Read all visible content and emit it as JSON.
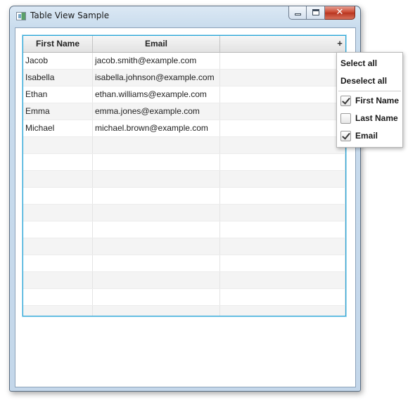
{
  "window": {
    "title": "Table View Sample"
  },
  "table": {
    "columns": [
      "First Name",
      "Email",
      ""
    ],
    "menu_button": "+",
    "rows": [
      {
        "first_name": "Jacob",
        "email": "jacob.smith@example.com"
      },
      {
        "first_name": "Isabella",
        "email": "isabella.johnson@example.com"
      },
      {
        "first_name": "Ethan",
        "email": "ethan.williams@example.com"
      },
      {
        "first_name": "Emma",
        "email": "emma.jones@example.com"
      },
      {
        "first_name": "Michael",
        "email": "michael.brown@example.com"
      }
    ],
    "visible_row_count": 17
  },
  "column_menu": {
    "select_all": "Select all",
    "deselect_all": "Deselect all",
    "columns": [
      {
        "label": "First Name",
        "checked": true
      },
      {
        "label": "Last Name",
        "checked": false
      },
      {
        "label": "Email",
        "checked": true
      }
    ]
  },
  "colors": {
    "focus_border": "#2aa4d6",
    "alt_row": "#f4f4f4",
    "close_button": "#c8442c"
  }
}
